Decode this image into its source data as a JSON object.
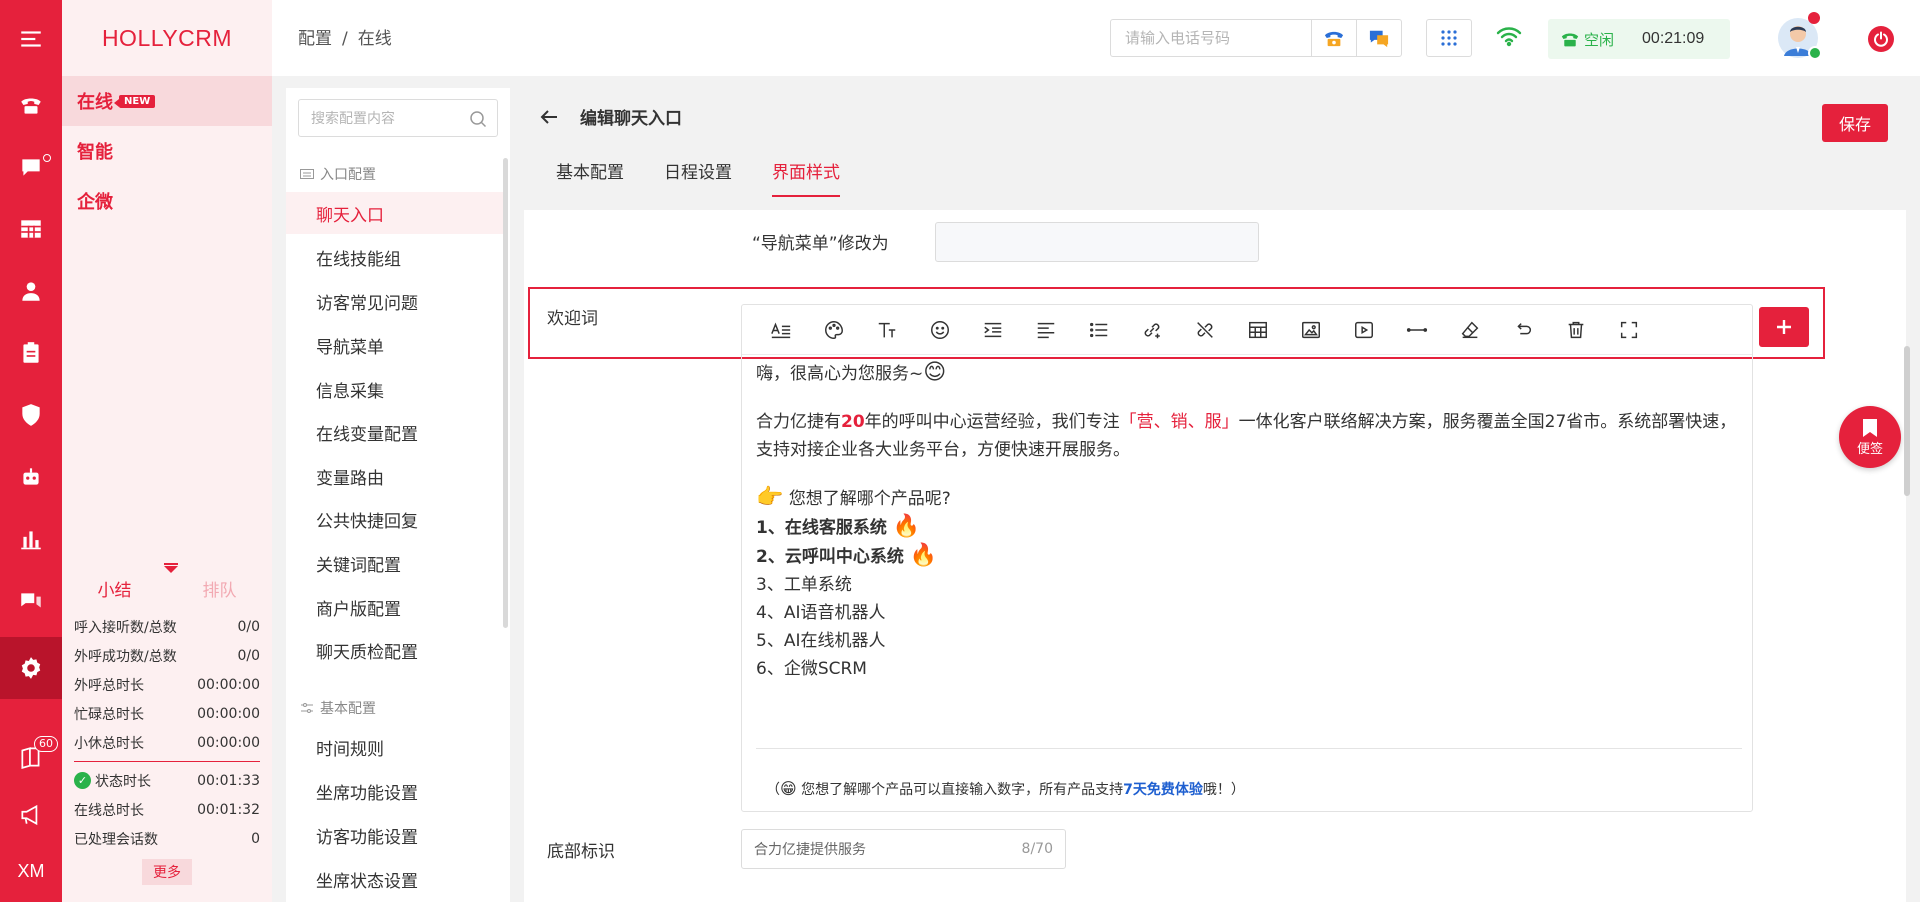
{
  "brand": "HOLLYCRM",
  "rail": {
    "text_label": "XM",
    "badge_count": "60"
  },
  "modules": [
    {
      "label": "在线",
      "badge": "NEW"
    },
    {
      "label": "智能"
    },
    {
      "label": "企微"
    }
  ],
  "stats": {
    "tab_summary": "小结",
    "tab_queue": "排队",
    "rows": [
      {
        "label": "呼入接听数/总数",
        "value": "0/0"
      },
      {
        "label": "外呼成功数/总数",
        "value": "0/0"
      },
      {
        "label": "外呼总时长",
        "value": "00:00:00"
      },
      {
        "label": "忙碌总时长",
        "value": "00:00:00"
      },
      {
        "label": "小休总时长",
        "value": "00:00:00"
      }
    ],
    "rows2": [
      {
        "label": "状态时长",
        "value": "00:01:33"
      },
      {
        "label": "在线总时长",
        "value": "00:01:32"
      },
      {
        "label": "已处理会话数",
        "value": "0"
      }
    ],
    "more": "更多"
  },
  "header": {
    "breadcrumb": [
      "配置",
      "在线"
    ],
    "phone_placeholder": "请输入电话号码",
    "status": "空闲",
    "timer": "00:21:09"
  },
  "config_menu": {
    "search_placeholder": "搜索配置内容",
    "group1": "入口配置",
    "items1": [
      "聊天入口",
      "在线技能组",
      "访客常见问题",
      "导航菜单",
      "信息采集",
      "在线变量配置",
      "变量路由",
      "公共快捷回复",
      "关键词配置",
      "商户版配置",
      "聊天质检配置"
    ],
    "group2": "基本配置",
    "items2": [
      "时间规则",
      "坐席功能设置",
      "访客功能设置",
      "坐席状态设置"
    ]
  },
  "page": {
    "title": "编辑聊天入口",
    "save": "保存",
    "tabs": [
      "基本配置",
      "日程设置",
      "界面样式"
    ]
  },
  "form": {
    "nav_label": "“导航菜单”修改为",
    "welcome_label": "欢迎词",
    "footer_label": "底部标识",
    "footer_value": "合力亿捷提供服务",
    "footer_count": "8/70"
  },
  "editor": {
    "greeting": "嗨，很高心为您服务~",
    "intro_a": "合力亿捷有",
    "intro_num": "20",
    "intro_b": "年的呼叫中心运营经验，我们专注",
    "intro_hl": "「营、销、服」",
    "intro_c": "一体化客户联络解决方案，服务覆盖全国27省市。系统部署快速，支持对接企业各大业务平台，方便快速开展服务。",
    "question": "您想了解哪个产品呢?",
    "products": [
      "1、在线客服系统",
      "2、云呼叫中心系统",
      "3、工单系统",
      "4、AI语音机器人",
      "5、AI在线机器人",
      "6、企微SCRM"
    ],
    "note_a": "（",
    "note_b": "您想了解哪个产品可以直接输入数字，所有产品支持",
    "note_hl": "7天免费体验",
    "note_c": "哦！）"
  },
  "float_btn": "便签",
  "colors": {
    "accent": "#e5213c",
    "status_green": "#2ab24a",
    "link_blue": "#1e5fd0"
  }
}
